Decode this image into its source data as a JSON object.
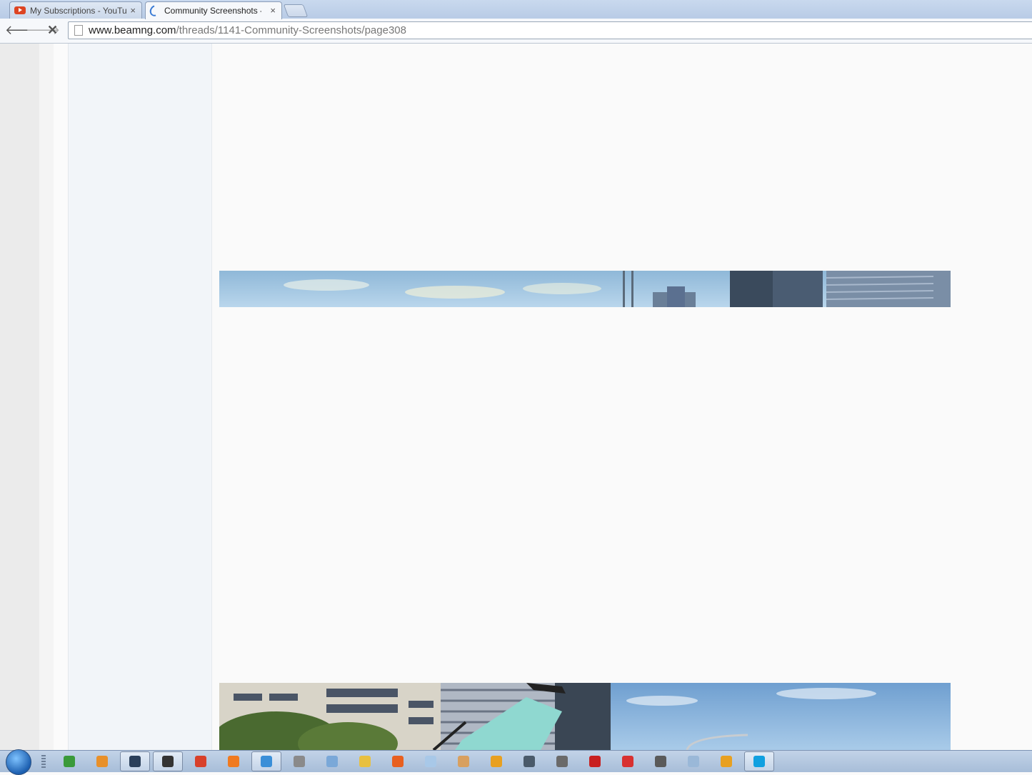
{
  "browser": {
    "tabs": [
      {
        "title": "My Subscriptions - YouTube",
        "close": "×",
        "active": false
      },
      {
        "title": "Community Screenshots - ",
        "close": "×",
        "active": true
      }
    ],
    "url_domain": "www.beamng.com",
    "url_path": "/threads/1141-Community-Screenshots/page308",
    "back": "🡐",
    "forward": "🡒",
    "stop": "✕"
  },
  "taskbar": {
    "items": [
      {
        "icon": "utorrent-icon",
        "color": "#3a9a3a"
      },
      {
        "icon": "media-player-icon",
        "color": "#e8902a"
      },
      {
        "icon": "steam-icon",
        "color": "#2a3f5a"
      },
      {
        "icon": "terminal-icon",
        "color": "#333333"
      },
      {
        "icon": "ccleaner-icon",
        "color": "#d8402a"
      },
      {
        "icon": "origin-icon",
        "color": "#f07a20"
      },
      {
        "icon": "chrome-icon",
        "color": "#3a8fd8"
      },
      {
        "icon": "audio-icon",
        "color": "#8a8a8a"
      },
      {
        "icon": "paint-icon",
        "color": "#7aa8d8"
      },
      {
        "icon": "explorer-icon",
        "color": "#e8c040"
      },
      {
        "icon": "firefox-icon",
        "color": "#e86020"
      },
      {
        "icon": "notepad-icon",
        "color": "#a8c8e8"
      },
      {
        "icon": "tool-icon",
        "color": "#d8a060"
      },
      {
        "icon": "winamp-icon",
        "color": "#e8a020"
      },
      {
        "icon": "settings-icon",
        "color": "#4a5a6a"
      },
      {
        "icon": "microphone-icon",
        "color": "#6a6a6a"
      },
      {
        "icon": "acrobat-icon",
        "color": "#c82020"
      },
      {
        "icon": "popcorn-icon",
        "color": "#d83030"
      },
      {
        "icon": "alien-icon",
        "color": "#5a5a5a"
      },
      {
        "icon": "calculator-icon",
        "color": "#9ab8d8"
      },
      {
        "icon": "headphones-icon",
        "color": "#e8a020"
      },
      {
        "icon": "skype-icon",
        "color": "#10a0e0"
      }
    ]
  }
}
